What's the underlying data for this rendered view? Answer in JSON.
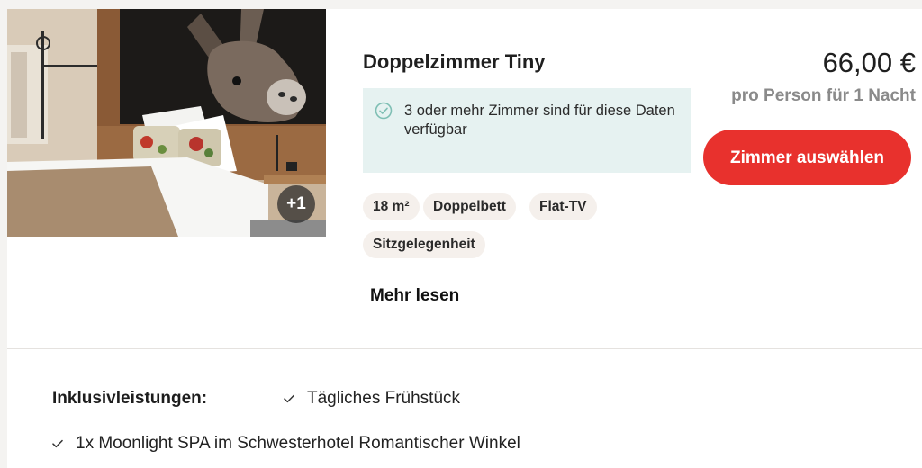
{
  "room": {
    "image_more_count": "+1",
    "title": "Doppelzimmer Tiny",
    "availability": "3 oder mehr Zimmer sind für diese Daten verfügbar",
    "tags": [
      "18 m²",
      "Doppelbett",
      "Flat-TV",
      "Sitzgelegenheit"
    ],
    "more_link": "Mehr lesen"
  },
  "pricing": {
    "price": "66,00 €",
    "price_note": "pro Person für 1 Nacht",
    "select_button": "Zimmer auswählen"
  },
  "inclusions": {
    "label": "Inklusivleistungen:",
    "items": [
      "Tägliches Frühstück",
      "1x Moonlight SPA im Schwesterhotel Romantischer Winkel"
    ]
  },
  "colors": {
    "accent": "#e8312d",
    "availability_background": "#e6f2f1",
    "check": "#7fbfb4",
    "tag_background": "#f5f0ec",
    "muted_text": "#8a8a8a"
  },
  "icons": {
    "availability": "check-circle-icon",
    "inclusion": "checkmark-icon"
  }
}
